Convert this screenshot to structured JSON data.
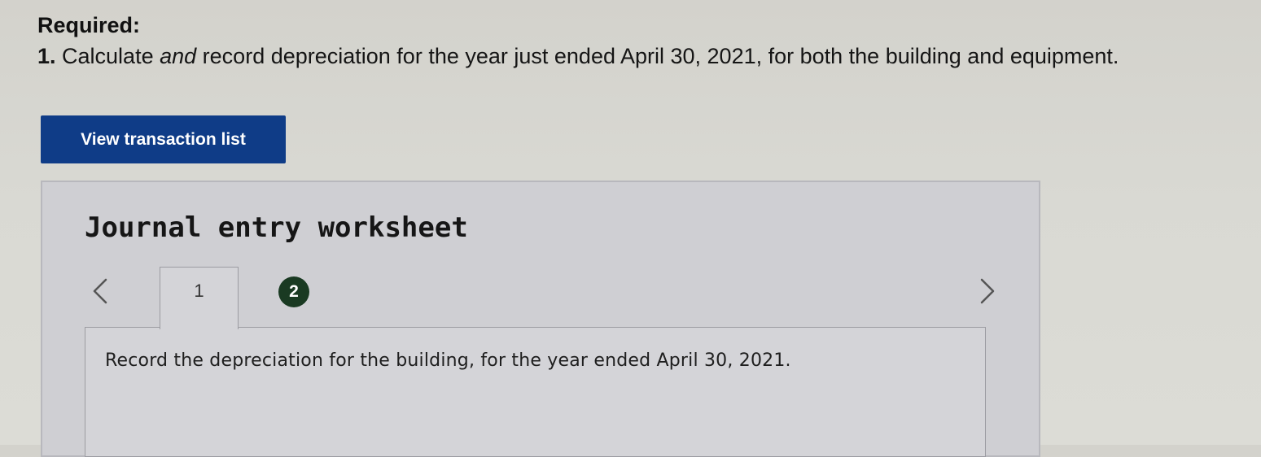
{
  "required": {
    "heading": "Required:",
    "item_number": "1.",
    "text_before": " Calculate ",
    "text_emphasis": "and",
    "text_after": " record depreciation for the year just ended April 30, 2021, for both the building and equipment."
  },
  "view_button": {
    "label": "View transaction list",
    "color": "#0f3c87"
  },
  "worksheet": {
    "title": "Journal entry worksheet",
    "nav": {
      "prev_icon": "chevron-left-icon",
      "next_icon": "chevron-right-icon"
    },
    "tabs": [
      {
        "label": "1",
        "active": true
      },
      {
        "label": "2",
        "active": false,
        "color": "#1a3a22"
      }
    ],
    "entry_instruction": "Record the depreciation for the building, for the year ended April 30, 2021."
  }
}
